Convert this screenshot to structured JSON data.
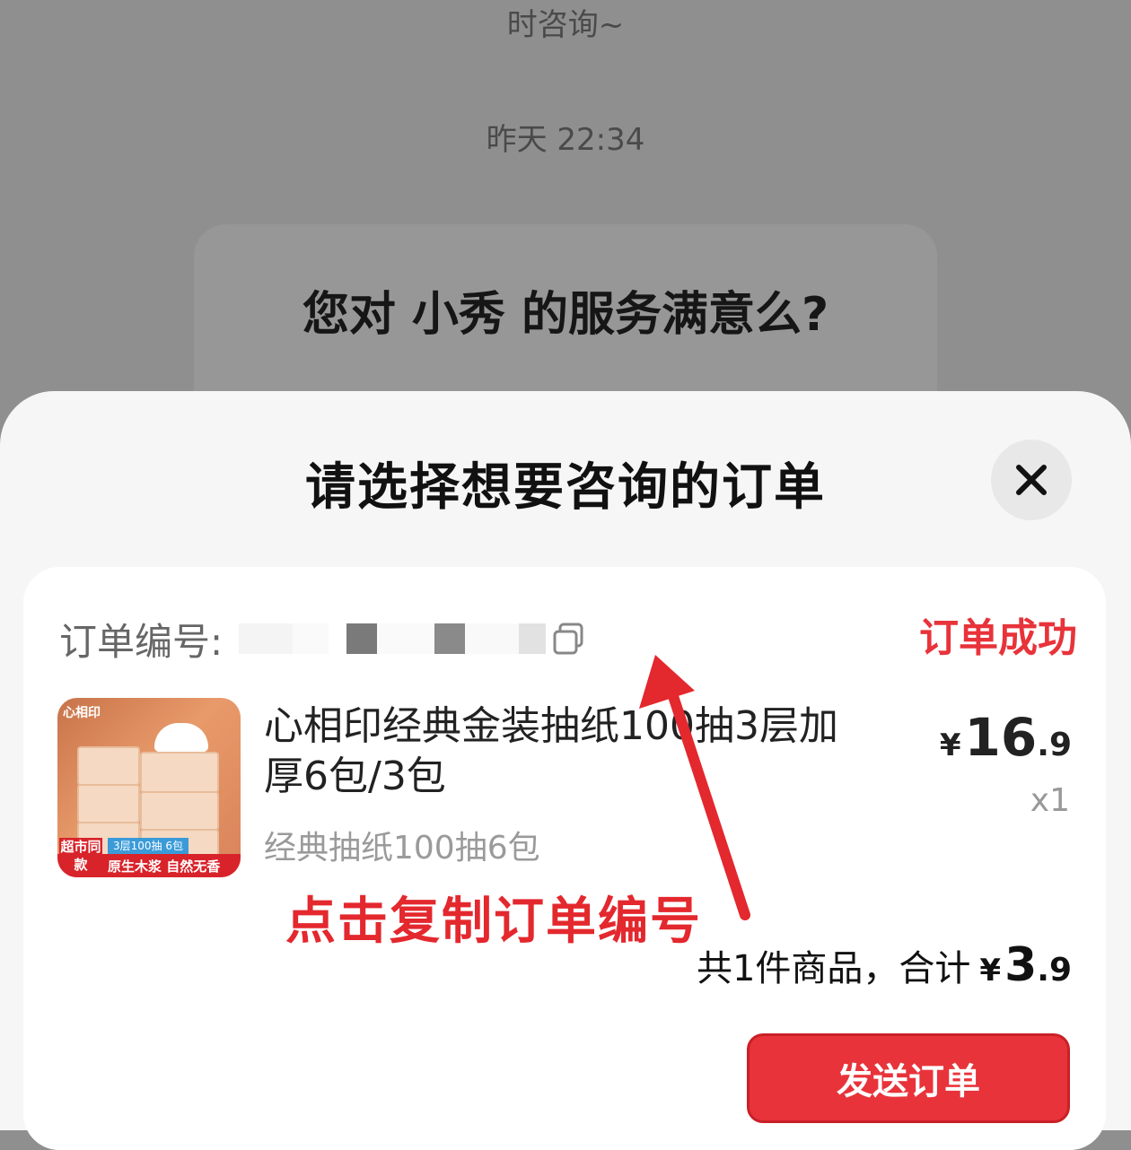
{
  "chat": {
    "top_partial_text": "时咨询~",
    "timestamp": "昨天 22:34",
    "survey_question": "您对 小秀 的服务满意么?"
  },
  "sheet": {
    "title": "请选择想要咨询的订单",
    "close_icon": "close-icon"
  },
  "order": {
    "number_label": "订单编号:",
    "copy_icon": "copy-icon",
    "status": "订单成功",
    "status_color": "#e8333a",
    "product": {
      "title": "心相印经典金装抽纸100抽3层加厚6包/3包",
      "spec": "经典抽纸100抽6包",
      "price_currency": "¥",
      "price_int": "16",
      "price_dec": ".9",
      "quantity": "x1",
      "thumb_tag": "超市同款",
      "thumb_badge": "3层100抽 6包",
      "thumb_ribbon": "原生木浆 自然无香"
    },
    "total_label": "共1件商品，合计",
    "total_currency": "¥",
    "total_int": "3",
    "total_dec": ".9",
    "send_button": "发送订单",
    "accent_color": "#e8333a"
  },
  "annotation": {
    "text": "点击复制订单编号",
    "color": "#e3282e"
  }
}
